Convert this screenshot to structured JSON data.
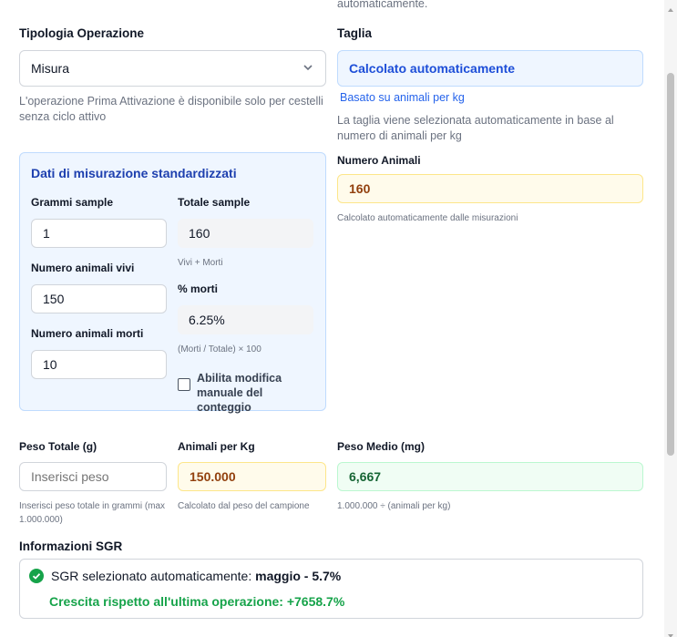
{
  "top_note": "automaticamente.",
  "tipologia": {
    "label": "Tipologia Operazione",
    "value": "Misura",
    "hint": "L'operazione Prima Attivazione è disponibile solo per cestelli senza ciclo attivo"
  },
  "taglia": {
    "label": "Taglia",
    "value": "Calcolato automaticamente",
    "link": "Basato su animali per kg",
    "hint": "La taglia viene selezionata automaticamente in base al numero di animali per kg"
  },
  "numero_animali": {
    "label": "Numero Animali",
    "value": "160",
    "hint": "Calcolato automaticamente dalle misurazioni"
  },
  "misurazione": {
    "title": "Dati di misurazione standardizzati",
    "grammi_sample": {
      "label": "Grammi sample",
      "value": "1"
    },
    "totale_sample": {
      "label": "Totale sample",
      "value": "160",
      "hint": "Vivi + Morti"
    },
    "animali_vivi": {
      "label": "Numero animali vivi",
      "value": "150"
    },
    "perc_morti": {
      "label": "% morti",
      "value": "6.25%",
      "hint": "(Morti / Totale) × 100"
    },
    "animali_morti": {
      "label": "Numero animali morti",
      "value": "10"
    },
    "abilita_label": "Abilita modifica manuale del conteggio"
  },
  "peso_totale": {
    "label": "Peso Totale (g)",
    "placeholder": "Inserisci peso",
    "hint": "Inserisci peso totale in grammi (max 1.000.000)"
  },
  "animali_per_kg": {
    "label": "Animali per Kg",
    "value": "150.000",
    "hint": "Calcolato dal peso del campione"
  },
  "peso_medio": {
    "label": "Peso Medio (mg)",
    "value": "6,667",
    "hint": "1.000.000 ÷ (animali per kg)"
  },
  "sgr": {
    "section_label": "Informazioni SGR",
    "selected_prefix": "SGR selezionato automaticamente:",
    "selected_value": "maggio - 5.7%",
    "growth": "Crescita rispetto all'ultima operazione: +7658.7%"
  },
  "colors": {
    "accent_blue": "#1e40af",
    "success_green": "#16a34a",
    "warning_text": "#92400e"
  }
}
